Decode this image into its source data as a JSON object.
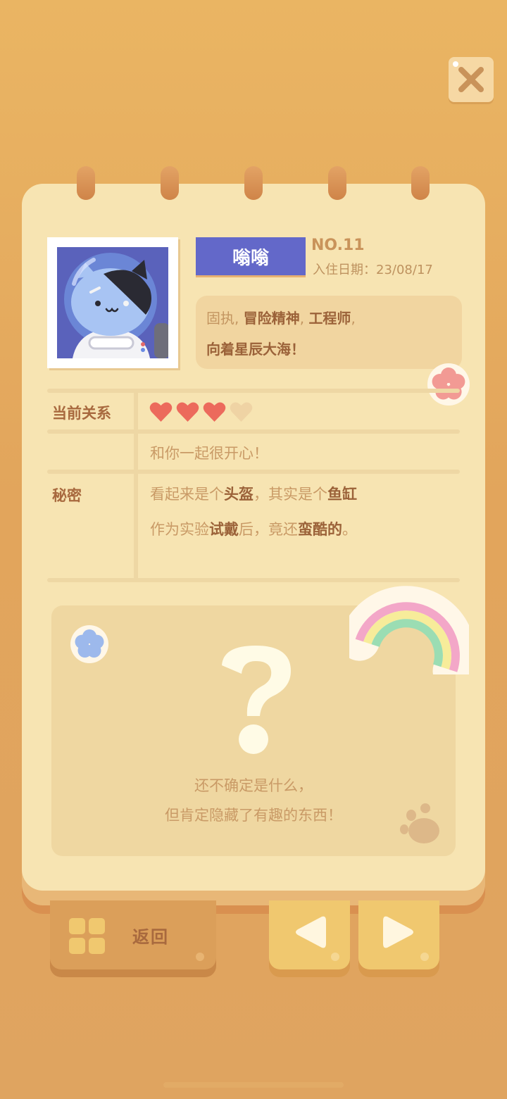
{
  "character": {
    "name": "嗡嗡",
    "number": "NO.11",
    "checkin_label": "入住日期：",
    "checkin_date": "23/08/17",
    "traits": {
      "line1_prefix": "固执, ",
      "line1_b1": "冒险精神",
      "line1_mid": ", ",
      "line1_b2": "工程师",
      "line1_suffix": ",",
      "line2": "向着星辰大海！"
    }
  },
  "relation": {
    "label": "当前关系",
    "hearts_filled": 3,
    "hearts_total": 4,
    "comment": "和你一起很开心！"
  },
  "secret": {
    "label": "秘密",
    "line1_a": "看起来是个",
    "line1_b": "头盔",
    "line1_c": "，其实是个",
    "line1_d": "鱼缸",
    "line2_a": "作为实验",
    "line2_b": "试戴",
    "line2_c": "后，竟还",
    "line2_d": "蛮酷的",
    "line2_e": "。"
  },
  "mystery": {
    "symbol": "?",
    "line1": "还不确定是什么，",
    "line2": "但肯定隐藏了有趣的东西！"
  },
  "buttons": {
    "back_label": "返回"
  },
  "colors": {
    "heart_filled": "#EC6A5C",
    "heart_empty": "#EFD3A4",
    "name_tag": "#6368C9"
  }
}
